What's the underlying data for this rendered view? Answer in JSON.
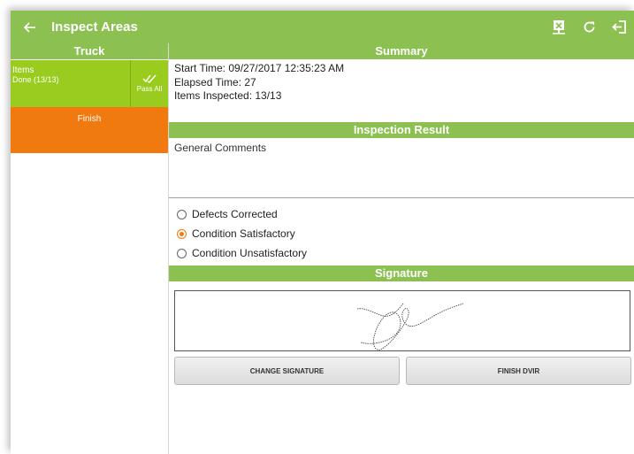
{
  "appbar": {
    "title": "Inspect Areas",
    "back_icon": "arrow-left-icon",
    "actions": [
      "export-icon",
      "refresh-icon",
      "logout-icon"
    ],
    "color": "#8cc152"
  },
  "left": {
    "header": "Truck",
    "items_label": "Items",
    "items_status": "Done (13/13)",
    "pass_all_label": "Pass All",
    "finish_label": "Finish",
    "items_color": "#99cc1e",
    "finish_color": "#f07a0f"
  },
  "summary": {
    "header": "Summary",
    "start_time": "Start Time: 09/27/2017 12:35:23 AM",
    "elapsed_time": "Elapsed Time: 27",
    "items_inspected": "Items Inspected: 13/13"
  },
  "result": {
    "header": "Inspection Result",
    "comments_placeholder": "General Comments",
    "options": [
      {
        "label": "Defects Corrected",
        "selected": false
      },
      {
        "label": "Condition Satisfactory",
        "selected": true
      },
      {
        "label": "Condition Unsatisfactory",
        "selected": false
      }
    ]
  },
  "signature": {
    "header": "Signature",
    "change_label": "CHANGE SIGNATURE",
    "finish_label": "FINISH DVIR"
  }
}
